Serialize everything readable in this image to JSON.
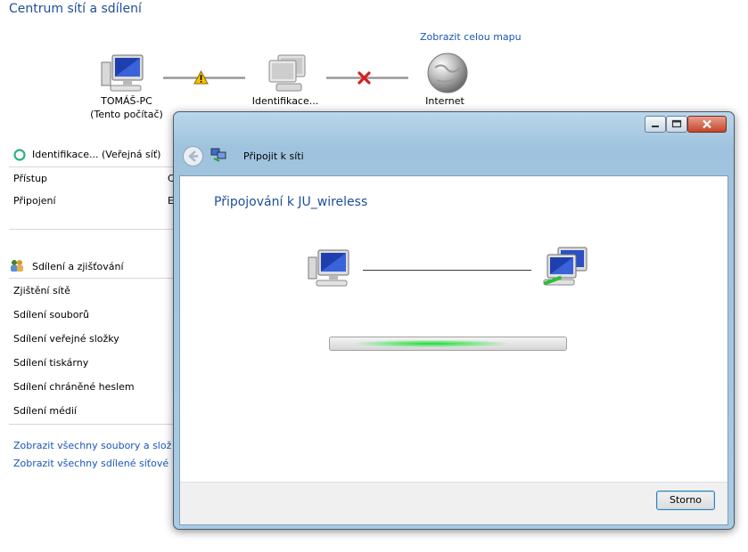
{
  "window_title": "Centrum sítí a sdílení",
  "map_link": "Zobrazit celou mapu",
  "network_map": {
    "computer_label": "TOMÁŠ-PC",
    "computer_sublabel": "(Tento počítač)",
    "network_label": "Identifikace...",
    "internet_label": "Internet"
  },
  "network_section": {
    "name": "Identifikace... (Veřejná síť)",
    "rows": [
      {
        "label": "Přístup",
        "value_partial": "C"
      },
      {
        "label": "Připojení",
        "value_partial": "E"
      }
    ]
  },
  "sharing_section": {
    "title": "Sdílení a zjišťování",
    "items": [
      "Zjištění sítě",
      "Sdílení souborů",
      "Sdílení veřejné složky",
      "Sdílení tiskárny",
      "Sdílení chráněné heslem",
      "Sdílení médií"
    ]
  },
  "bottom_links": [
    "Zobrazit všechny soubory a složky",
    "Zobrazit všechny sdílené síťové slo"
  ],
  "dialog": {
    "title": "Připojit k síti",
    "heading": "Připojování k JU_wireless",
    "progress_position": 0.43,
    "cancel_label": "Storno",
    "titlebar_buttons": {
      "minimize": "minimize-icon",
      "maximize": "maximize-icon",
      "close": "close-icon"
    }
  },
  "colors": {
    "title_blue": "#1f4e97",
    "link_blue": "#1a55b8",
    "warning": "#f5c400",
    "error": "#d71f1f",
    "progress_green": "#27d43a"
  }
}
